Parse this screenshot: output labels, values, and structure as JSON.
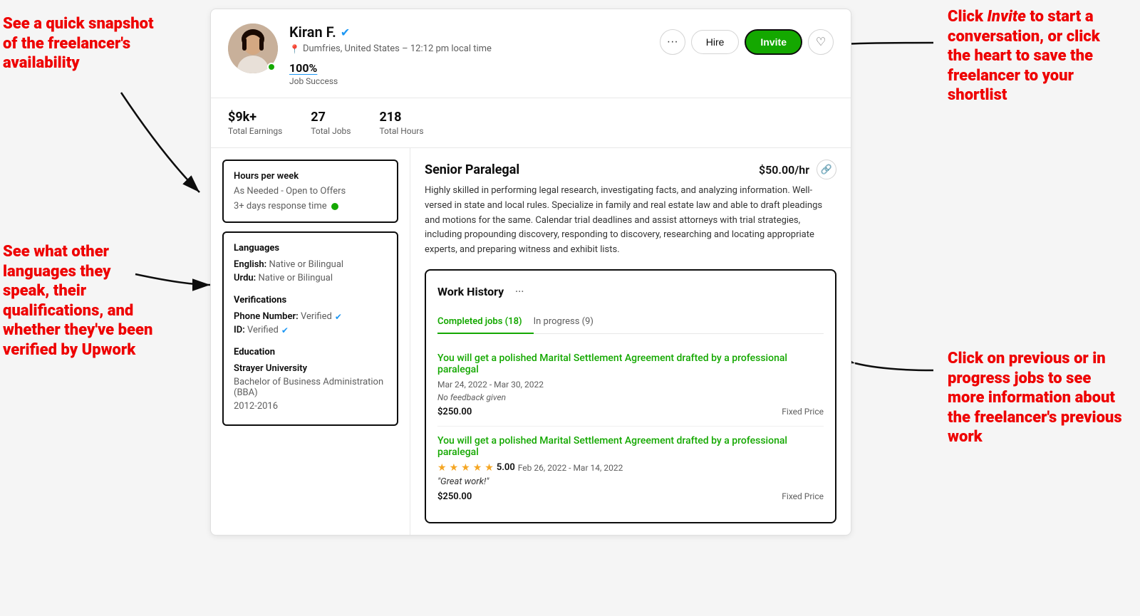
{
  "annotations": {
    "top_left": "See a quick snapshot of the freelancer's availability",
    "mid_left": "See what other languages they speak, their qualifications, and whether they've been verified by Upwork",
    "top_right_prefix": "Click ",
    "top_right_italic": "Invite",
    "top_right_suffix": " to start a conversation, or click the heart to save the freelancer to your shortlist",
    "bottom_right": "Click on previous or in progress jobs to see more information about the freelancer's previous work"
  },
  "profile": {
    "name": "Kiran F.",
    "verified": true,
    "location": "Dumfries, United States – 12:12 pm local time",
    "job_success_percent": "100%",
    "job_success_label": "Job Success",
    "online": true
  },
  "stats": {
    "earnings_value": "$9k+",
    "earnings_label": "Total Earnings",
    "jobs_value": "27",
    "jobs_label": "Total Jobs",
    "hours_value": "218",
    "hours_label": "Total Hours"
  },
  "availability": {
    "title": "Hours per week",
    "value": "As Needed - Open to Offers",
    "response": "3+ days response time"
  },
  "sidebar": {
    "languages_title": "Languages",
    "languages": [
      {
        "label": "English:",
        "value": "Native or Bilingual"
      },
      {
        "label": "Urdu:",
        "value": "Native or Bilingual"
      }
    ],
    "verifications_title": "Verifications",
    "verifications": [
      {
        "label": "Phone Number:",
        "value": "Verified"
      },
      {
        "label": "ID:",
        "value": "Verified"
      }
    ],
    "education_title": "Education",
    "university": "Strayer University",
    "degree": "Bachelor of Business Administration (BBA)",
    "years": "2012-2016"
  },
  "freelancer": {
    "title": "Senior Paralegal",
    "rate": "$50.00/hr",
    "bio": "Highly skilled in performing legal research, investigating facts, and analyzing information. Well-versed in state and local rules. Specialize in family and real estate law and able to draft pleadings and motions for the same. Calendar trial deadlines and assist attorneys with trial strategies, including propounding discovery, responding to discovery, researching and locating appropriate experts, and preparing witness and exhibit lists."
  },
  "work_history": {
    "title": "Work History",
    "tabs": [
      {
        "label": "Completed jobs (18)",
        "active": true
      },
      {
        "label": "In progress (9)",
        "active": false
      }
    ],
    "jobs": [
      {
        "title": "You will get a polished Marital Settlement Agreement drafted by a professional paralegal",
        "dates": "Mar 24, 2022 - Mar 30, 2022",
        "feedback": "No feedback given",
        "amount": "$250.00",
        "type": "Fixed Price",
        "rating": null
      },
      {
        "title": "You will get a polished Marital Settlement Agreement drafted by a professional paralegal",
        "dates": "Feb 26, 2022 - Mar 14, 2022",
        "rating": "5.00",
        "rating_stars": 5,
        "review": "\"Great work!\"",
        "amount": "$250.00",
        "type": "Fixed Price"
      }
    ]
  },
  "buttons": {
    "dots": "···",
    "hire": "Hire",
    "invite": "Invite",
    "heart": "♡"
  }
}
